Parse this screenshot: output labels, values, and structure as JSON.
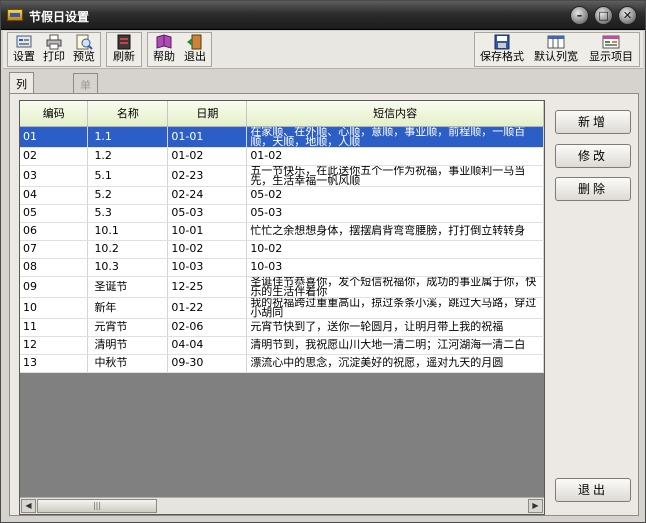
{
  "window": {
    "title": "节假日设置"
  },
  "toolbar": {
    "left": [
      {
        "label": "设置",
        "icon": "settings-icon"
      },
      {
        "label": "打印",
        "icon": "printer-icon"
      },
      {
        "label": "预览",
        "icon": "preview-icon"
      },
      {
        "label": "刷新",
        "icon": "refresh-icon"
      },
      {
        "label": "帮助",
        "icon": "help-book-icon"
      },
      {
        "label": "退出",
        "icon": "exit-door-icon"
      }
    ],
    "right": [
      {
        "label": "保存格式",
        "icon": "save-format-icon"
      },
      {
        "label": "默认列宽",
        "icon": "column-width-icon"
      },
      {
        "label": "显示项目",
        "icon": "display-items-icon"
      }
    ]
  },
  "tabs": [
    {
      "label": "列表视图",
      "active": true
    },
    {
      "label": "单张视图",
      "active": false
    }
  ],
  "grid": {
    "columns": [
      "编码",
      "名称",
      "日期",
      "短信内容"
    ],
    "rows": [
      {
        "code": "01",
        "name": "1.1",
        "date": "01-01",
        "content": "在家顺、在外顺、心顺，意顺，事业顺，前程顺，一顺百顺，天顺，地顺，人顺",
        "selected": true
      },
      {
        "code": "02",
        "name": "1.2",
        "date": "01-02",
        "content": "01-02",
        "selected": false
      },
      {
        "code": "03",
        "name": "5.1",
        "date": "02-23",
        "content": "五一节快乐，在此送你五个一作为祝福，事业顺利一马当先，生活幸福一帆风顺",
        "selected": false
      },
      {
        "code": "04",
        "name": "5.2",
        "date": "02-24",
        "content": "05-02",
        "selected": false
      },
      {
        "code": "05",
        "name": "5.3",
        "date": "05-03",
        "content": "05-03",
        "selected": false
      },
      {
        "code": "06",
        "name": "10.1",
        "date": "10-01",
        "content": "忙忙之余想想身体，摆摆肩背弯弯腰膀，打打倒立转转身",
        "selected": false
      },
      {
        "code": "07",
        "name": "10.2",
        "date": "10-02",
        "content": "10-02",
        "selected": false
      },
      {
        "code": "08",
        "name": "10.3",
        "date": "10-03",
        "content": "10-03",
        "selected": false
      },
      {
        "code": "09",
        "name": "圣诞节",
        "date": "12-25",
        "content": "圣诞佳节恭喜你，发个短信祝福你，成功的事业属于你，快乐的生活伴着你",
        "selected": false
      },
      {
        "code": "10",
        "name": "新年",
        "date": "01-22",
        "content": "我的祝福跨过重重高山，掠过条条小溪，跳过大马路，穿过小胡同",
        "selected": false
      },
      {
        "code": "11",
        "name": "元宵节",
        "date": "02-06",
        "content": "元宵节快到了，送你一轮圆月，让明月带上我的祝福",
        "selected": false
      },
      {
        "code": "12",
        "name": "清明节",
        "date": "04-04",
        "content": "清明节到，我祝愿山川大地一清二明；江河湖海一清二白",
        "selected": false
      },
      {
        "code": "13",
        "name": "中秋节",
        "date": "09-30",
        "content": "漂流心中的思念，沉淀美好的祝愿，遥对九天的月圆",
        "selected": false
      }
    ]
  },
  "buttons": {
    "add": "新增",
    "edit": "修改",
    "delete": "删除",
    "exit": "退出"
  },
  "colors": {
    "selected_row": "#2b5ec7",
    "header_bg": "#e4f0c9",
    "titlebar": "#2d2d2d"
  }
}
